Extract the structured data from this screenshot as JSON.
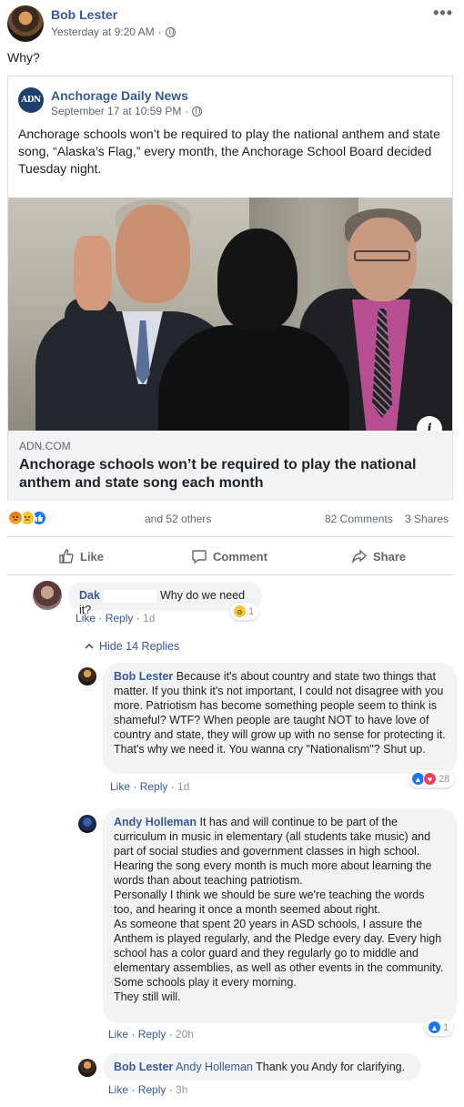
{
  "post": {
    "author": "Bob Lester",
    "timestamp": "Yesterday at 9:20 AM",
    "privacy_icon": "globe-icon",
    "more_label": "•••",
    "text": "Why?"
  },
  "shared": {
    "source_logo": "ADN",
    "source_name": "Anchorage Daily News",
    "timestamp": "September 17 at 10:59 PM",
    "text": "Anchorage schools won’t be required to play the national anthem and state song, “Alaska’s Flag,” every month, the Anchorage School Board decided Tuesday night.",
    "info_label": "i",
    "link_domain": "ADN.COM",
    "link_title": "Anchorage schools won’t be required to play the national anthem and state song each month"
  },
  "stats": {
    "reactions": [
      "angry",
      "sad",
      "like"
    ],
    "others": "and 52 others",
    "comments": "82 Comments",
    "shares": "3 Shares"
  },
  "actions": {
    "like": "Like",
    "comment": "Comment",
    "share": "Share"
  },
  "comments": [
    {
      "author": "Dak",
      "text": "Why do we need it?",
      "like": "Like",
      "reply": "Reply",
      "time": "1d",
      "reaction_count": "1"
    }
  ],
  "replies_toggle": "Hide 14 Replies",
  "replies": [
    {
      "author": "Bob Lester",
      "text": "Because it's about country and state two things that matter. If you think it's not important, I could not disagree with you more. Patriotism has become something people seem to think is shameful? WTF? When people are taught NOT to have love of country and state, they will grow up with no sense for protecting it. That's why we need it. You wanna cry \"Nationalism\"? Shut up.",
      "like": "Like",
      "reply": "Reply",
      "time": "1d",
      "reaction_count": "28"
    },
    {
      "author": "Andy Holleman",
      "text": "It has and will continue to be part of the curriculum in music in elementary (all students take music) and part of social studies and government classes in high school. Hearing the song every month is much more about learning the words than about teaching patriotism.\nPersonally I think we should be sure we're teaching the words too, and hearing it once a month seemed about right.\nAs someone that spent 20 years in ASD schools, I assure the Anthem is played regularly, and the Pledge every day. Every high school has a color guard and they regularly go to middle and elementary assemblies, as well as other events in the community.\nSome schools play it every morning.\nThey still will.",
      "like": "Like",
      "reply": "Reply",
      "time": "20h",
      "reaction_count": "1"
    },
    {
      "author": "Bob Lester",
      "tag": "Andy Holleman",
      "text": "Thank you Andy for clarifying.",
      "like": "Like",
      "reply": "Reply",
      "time": "3h"
    }
  ],
  "colors": {
    "link": "#385898",
    "meta": "#616770",
    "bubble": "#f2f3f5",
    "like_blue": "#1877f2"
  }
}
